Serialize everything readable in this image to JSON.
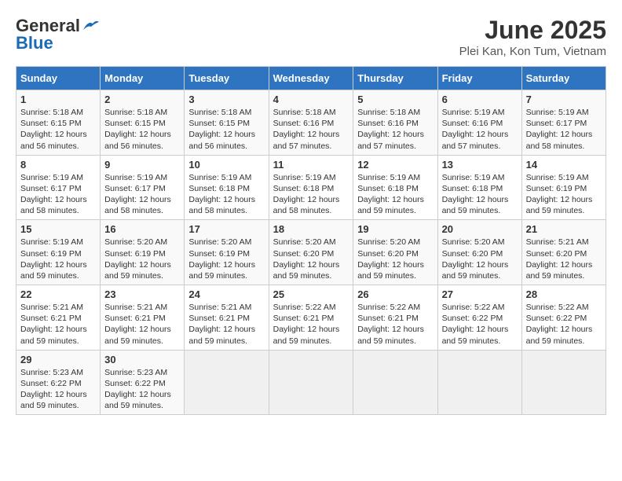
{
  "header": {
    "logo_line1": "General",
    "logo_line2": "Blue",
    "title": "June 2025",
    "subtitle": "Plei Kan, Kon Tum, Vietnam"
  },
  "days_of_week": [
    "Sunday",
    "Monday",
    "Tuesday",
    "Wednesday",
    "Thursday",
    "Friday",
    "Saturday"
  ],
  "weeks": [
    [
      {
        "num": "1",
        "sunrise": "5:18 AM",
        "sunset": "6:15 PM",
        "daylight": "12 hours and 56 minutes."
      },
      {
        "num": "2",
        "sunrise": "5:18 AM",
        "sunset": "6:15 PM",
        "daylight": "12 hours and 56 minutes."
      },
      {
        "num": "3",
        "sunrise": "5:18 AM",
        "sunset": "6:15 PM",
        "daylight": "12 hours and 56 minutes."
      },
      {
        "num": "4",
        "sunrise": "5:18 AM",
        "sunset": "6:16 PM",
        "daylight": "12 hours and 57 minutes."
      },
      {
        "num": "5",
        "sunrise": "5:18 AM",
        "sunset": "6:16 PM",
        "daylight": "12 hours and 57 minutes."
      },
      {
        "num": "6",
        "sunrise": "5:19 AM",
        "sunset": "6:16 PM",
        "daylight": "12 hours and 57 minutes."
      },
      {
        "num": "7",
        "sunrise": "5:19 AM",
        "sunset": "6:17 PM",
        "daylight": "12 hours and 58 minutes."
      }
    ],
    [
      {
        "num": "8",
        "sunrise": "5:19 AM",
        "sunset": "6:17 PM",
        "daylight": "12 hours and 58 minutes."
      },
      {
        "num": "9",
        "sunrise": "5:19 AM",
        "sunset": "6:17 PM",
        "daylight": "12 hours and 58 minutes."
      },
      {
        "num": "10",
        "sunrise": "5:19 AM",
        "sunset": "6:18 PM",
        "daylight": "12 hours and 58 minutes."
      },
      {
        "num": "11",
        "sunrise": "5:19 AM",
        "sunset": "6:18 PM",
        "daylight": "12 hours and 58 minutes."
      },
      {
        "num": "12",
        "sunrise": "5:19 AM",
        "sunset": "6:18 PM",
        "daylight": "12 hours and 59 minutes."
      },
      {
        "num": "13",
        "sunrise": "5:19 AM",
        "sunset": "6:18 PM",
        "daylight": "12 hours and 59 minutes."
      },
      {
        "num": "14",
        "sunrise": "5:19 AM",
        "sunset": "6:19 PM",
        "daylight": "12 hours and 59 minutes."
      }
    ],
    [
      {
        "num": "15",
        "sunrise": "5:19 AM",
        "sunset": "6:19 PM",
        "daylight": "12 hours and 59 minutes."
      },
      {
        "num": "16",
        "sunrise": "5:20 AM",
        "sunset": "6:19 PM",
        "daylight": "12 hours and 59 minutes."
      },
      {
        "num": "17",
        "sunrise": "5:20 AM",
        "sunset": "6:19 PM",
        "daylight": "12 hours and 59 minutes."
      },
      {
        "num": "18",
        "sunrise": "5:20 AM",
        "sunset": "6:20 PM",
        "daylight": "12 hours and 59 minutes."
      },
      {
        "num": "19",
        "sunrise": "5:20 AM",
        "sunset": "6:20 PM",
        "daylight": "12 hours and 59 minutes."
      },
      {
        "num": "20",
        "sunrise": "5:20 AM",
        "sunset": "6:20 PM",
        "daylight": "12 hours and 59 minutes."
      },
      {
        "num": "21",
        "sunrise": "5:21 AM",
        "sunset": "6:20 PM",
        "daylight": "12 hours and 59 minutes."
      }
    ],
    [
      {
        "num": "22",
        "sunrise": "5:21 AM",
        "sunset": "6:21 PM",
        "daylight": "12 hours and 59 minutes."
      },
      {
        "num": "23",
        "sunrise": "5:21 AM",
        "sunset": "6:21 PM",
        "daylight": "12 hours and 59 minutes."
      },
      {
        "num": "24",
        "sunrise": "5:21 AM",
        "sunset": "6:21 PM",
        "daylight": "12 hours and 59 minutes."
      },
      {
        "num": "25",
        "sunrise": "5:22 AM",
        "sunset": "6:21 PM",
        "daylight": "12 hours and 59 minutes."
      },
      {
        "num": "26",
        "sunrise": "5:22 AM",
        "sunset": "6:21 PM",
        "daylight": "12 hours and 59 minutes."
      },
      {
        "num": "27",
        "sunrise": "5:22 AM",
        "sunset": "6:22 PM",
        "daylight": "12 hours and 59 minutes."
      },
      {
        "num": "28",
        "sunrise": "5:22 AM",
        "sunset": "6:22 PM",
        "daylight": "12 hours and 59 minutes."
      }
    ],
    [
      {
        "num": "29",
        "sunrise": "5:23 AM",
        "sunset": "6:22 PM",
        "daylight": "12 hours and 59 minutes."
      },
      {
        "num": "30",
        "sunrise": "5:23 AM",
        "sunset": "6:22 PM",
        "daylight": "12 hours and 59 minutes."
      },
      null,
      null,
      null,
      null,
      null
    ]
  ]
}
